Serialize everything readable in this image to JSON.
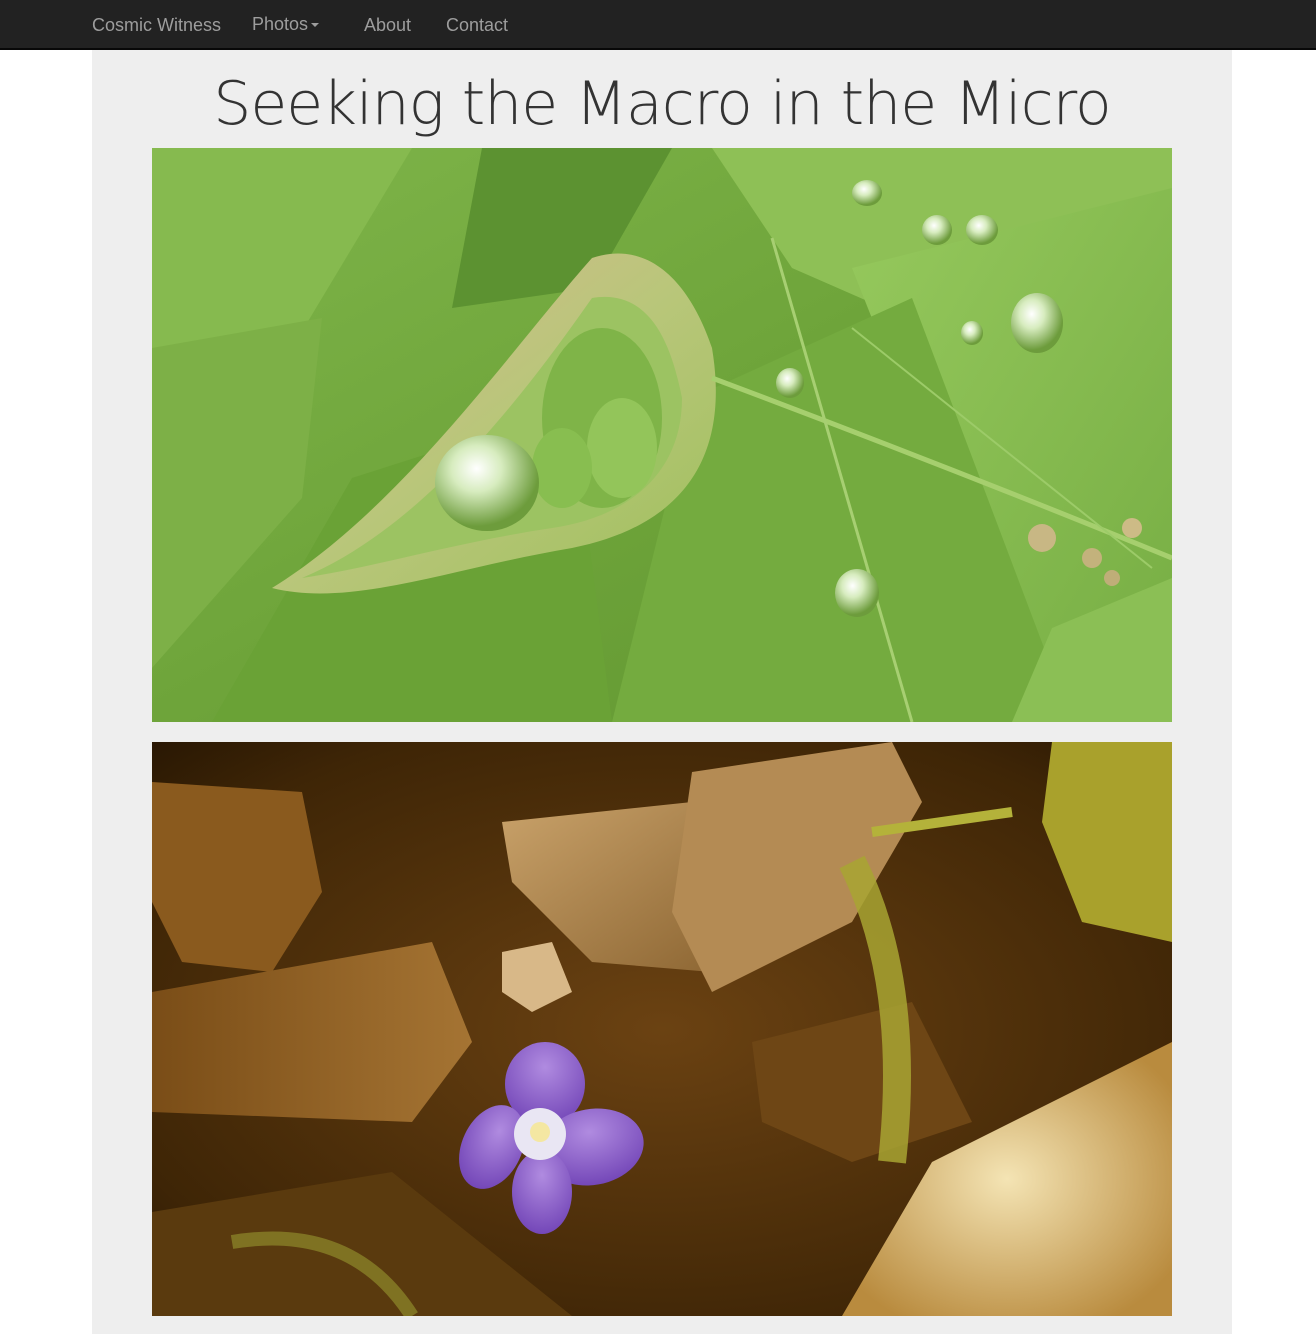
{
  "navbar": {
    "brand": "Cosmic Witness",
    "items": [
      {
        "label": "Photos",
        "has_dropdown": true
      },
      {
        "label": "About"
      },
      {
        "label": "Contact"
      }
    ],
    "background": "#222222",
    "text_color": "#9d9d9d"
  },
  "page": {
    "title": "Seeking the Macro in the Micro",
    "background": "#eeeeee"
  },
  "photos": [
    {
      "subject": "green leaves with water droplets"
    },
    {
      "subject": "small purple flower among soil, rocks and moss"
    }
  ]
}
